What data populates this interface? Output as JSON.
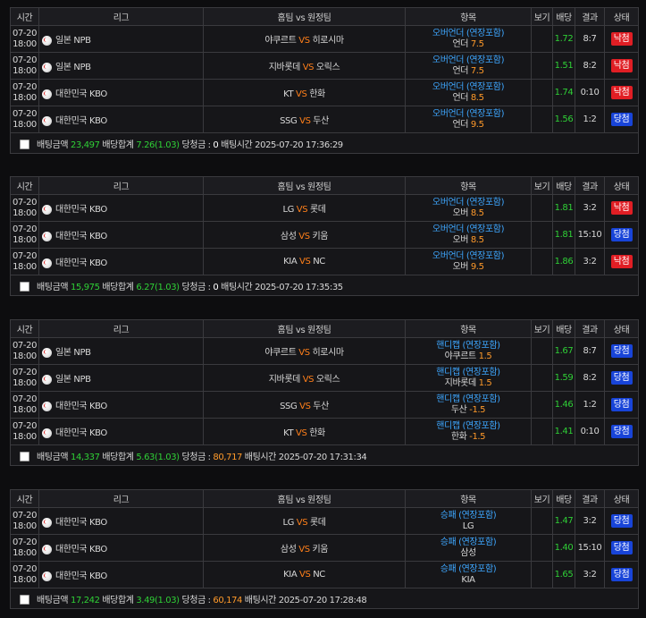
{
  "headers": {
    "time": "시간",
    "league": "리그",
    "match": "홈팀 vs 원정팀",
    "item": "항목",
    "view": "보기",
    "odds": "배당",
    "result": "결과",
    "status": "상태"
  },
  "vs_label": "VS",
  "summary_labels": {
    "amount": "배팅금액",
    "total": "배당합계",
    "payout": "당청금 :",
    "time": "배팅시간"
  },
  "slips": [
    {
      "rows": [
        {
          "date": "07-20",
          "time": "18:00",
          "league": "일본 NPB",
          "home": "야쿠르트",
          "away": "히로시마",
          "bet_type": "오버언더 (연장포함)",
          "pick": "언더",
          "pick_value": "7.5",
          "view": "",
          "odds": "1.72",
          "result": "8:7",
          "status": "낙첨",
          "status_kind": "lose"
        },
        {
          "date": "07-20",
          "time": "18:00",
          "league": "일본 NPB",
          "home": "지바롯데",
          "away": "오릭스",
          "bet_type": "오버언더 (연장포함)",
          "pick": "언더",
          "pick_value": "7.5",
          "view": "",
          "odds": "1.51",
          "result": "8:2",
          "status": "낙첨",
          "status_kind": "lose"
        },
        {
          "date": "07-20",
          "time": "18:00",
          "league": "대한민국 KBO",
          "home": "KT",
          "away": "한화",
          "bet_type": "오버언더 (연장포함)",
          "pick": "언더",
          "pick_value": "8.5",
          "view": "",
          "odds": "1.74",
          "result": "0:10",
          "status": "낙첨",
          "status_kind": "lose"
        },
        {
          "date": "07-20",
          "time": "18:00",
          "league": "대한민국 KBO",
          "home": "SSG",
          "away": "두산",
          "bet_type": "오버언더 (연장포함)",
          "pick": "언더",
          "pick_value": "9.5",
          "view": "",
          "odds": "1.56",
          "result": "1:2",
          "status": "당첨",
          "status_kind": "win"
        }
      ],
      "amount": "23,497",
      "total": "7.26(1.03)",
      "payout": "0",
      "bet_time": "2025-07-20 17:36:29"
    },
    {
      "rows": [
        {
          "date": "07-20",
          "time": "18:00",
          "league": "대한민국 KBO",
          "home": "LG",
          "away": "롯데",
          "bet_type": "오버언더 (연장포함)",
          "pick": "오버",
          "pick_value": "8.5",
          "view": "",
          "odds": "1.81",
          "result": "3:2",
          "status": "낙첨",
          "status_kind": "lose"
        },
        {
          "date": "07-20",
          "time": "18:00",
          "league": "대한민국 KBO",
          "home": "삼성",
          "away": "키움",
          "bet_type": "오버언더 (연장포함)",
          "pick": "오버",
          "pick_value": "8.5",
          "view": "",
          "odds": "1.81",
          "result": "15:10",
          "status": "당첨",
          "status_kind": "win"
        },
        {
          "date": "07-20",
          "time": "18:00",
          "league": "대한민국 KBO",
          "home": "KIA",
          "away": "NC",
          "bet_type": "오버언더 (연장포함)",
          "pick": "오버",
          "pick_value": "9.5",
          "view": "",
          "odds": "1.86",
          "result": "3:2",
          "status": "낙첨",
          "status_kind": "lose"
        }
      ],
      "amount": "15,975",
      "total": "6.27(1.03)",
      "payout": "0",
      "bet_time": "2025-07-20 17:35:35"
    },
    {
      "rows": [
        {
          "date": "07-20",
          "time": "18:00",
          "league": "일본 NPB",
          "home": "야쿠르트",
          "away": "히로시마",
          "bet_type": "핸디캡 (연장포함)",
          "pick": "야쿠르트",
          "pick_value": "1.5",
          "view": "",
          "odds": "1.67",
          "result": "8:7",
          "status": "당첨",
          "status_kind": "win"
        },
        {
          "date": "07-20",
          "time": "18:00",
          "league": "일본 NPB",
          "home": "지바롯데",
          "away": "오릭스",
          "bet_type": "핸디캡 (연장포함)",
          "pick": "지바롯데",
          "pick_value": "1.5",
          "view": "",
          "odds": "1.59",
          "result": "8:2",
          "status": "당첨",
          "status_kind": "win"
        },
        {
          "date": "07-20",
          "time": "18:00",
          "league": "대한민국 KBO",
          "home": "SSG",
          "away": "두산",
          "bet_type": "핸디캡 (연장포함)",
          "pick": "두산",
          "pick_value": "-1.5",
          "view": "",
          "odds": "1.46",
          "result": "1:2",
          "status": "당첨",
          "status_kind": "win"
        },
        {
          "date": "07-20",
          "time": "18:00",
          "league": "대한민국 KBO",
          "home": "KT",
          "away": "한화",
          "bet_type": "핸디캡 (연장포함)",
          "pick": "한화",
          "pick_value": "-1.5",
          "view": "",
          "odds": "1.41",
          "result": "0:10",
          "status": "당첨",
          "status_kind": "win"
        }
      ],
      "amount": "14,337",
      "total": "5.63(1.03)",
      "payout": "80,717",
      "bet_time": "2025-07-20 17:31:34"
    },
    {
      "rows": [
        {
          "date": "07-20",
          "time": "18:00",
          "league": "대한민국 KBO",
          "home": "LG",
          "away": "롯데",
          "bet_type": "승패 (연장포함)",
          "pick": "LG",
          "pick_value": "",
          "view": "",
          "odds": "1.47",
          "result": "3:2",
          "status": "당첨",
          "status_kind": "win"
        },
        {
          "date": "07-20",
          "time": "18:00",
          "league": "대한민국 KBO",
          "home": "삼성",
          "away": "키움",
          "bet_type": "승패 (연장포함)",
          "pick": "삼성",
          "pick_value": "",
          "view": "",
          "odds": "1.40",
          "result": "15:10",
          "status": "당첨",
          "status_kind": "win"
        },
        {
          "date": "07-20",
          "time": "18:00",
          "league": "대한민국 KBO",
          "home": "KIA",
          "away": "NC",
          "bet_type": "승패 (연장포함)",
          "pick": "KIA",
          "pick_value": "",
          "view": "",
          "odds": "1.65",
          "result": "3:2",
          "status": "당첨",
          "status_kind": "win"
        }
      ],
      "amount": "17,242",
      "total": "3.49(1.03)",
      "payout": "60,174",
      "bet_time": "2025-07-20 17:28:48"
    }
  ],
  "colors": {
    "win": "#1844d8",
    "lose": "#e01e24",
    "odds": "#2fd036",
    "vs": "#ff7f1a",
    "bet_type": "#3ea7ff",
    "pick_value": "#ff9a2a"
  }
}
